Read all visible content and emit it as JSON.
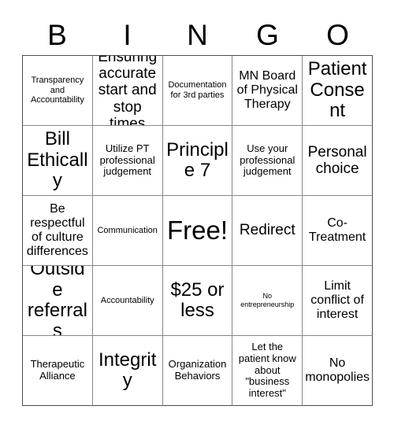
{
  "card": {
    "header_letters": [
      "B",
      "I",
      "N",
      "G",
      "O"
    ],
    "rows": [
      [
        {
          "text": "Transparency and Accountability",
          "size": "s-sm"
        },
        {
          "text": "Ensuring accurate start and stop times",
          "size": "s-xl"
        },
        {
          "text": "Documentation for 3rd parties",
          "size": "s-sm"
        },
        {
          "text": "MN Board of Physical Therapy",
          "size": "s-lg"
        },
        {
          "text": "Patient Consent",
          "size": "s-xxl"
        }
      ],
      [
        {
          "text": "Bill Ethically",
          "size": "s-xxl"
        },
        {
          "text": "Utilize PT professional judgement",
          "size": "s-md"
        },
        {
          "text": "Principle 7",
          "size": "s-xxl"
        },
        {
          "text": "Use your professional judgement",
          "size": "s-md"
        },
        {
          "text": "Personal choice",
          "size": "s-xl"
        }
      ],
      [
        {
          "text": "Be respectful of culture differences",
          "size": "s-lg"
        },
        {
          "text": "Communication",
          "size": "s-sm"
        },
        {
          "text": "Free!",
          "size": "s-free"
        },
        {
          "text": "Redirect",
          "size": "s-xl"
        },
        {
          "text": "Co-Treatment",
          "size": "s-lg"
        }
      ],
      [
        {
          "text": "Outside referrals",
          "size": "s-xxl"
        },
        {
          "text": "Accountability",
          "size": "s-sm"
        },
        {
          "text": "$25 or less",
          "size": "s-xxl"
        },
        {
          "text": "No entrepreneurship",
          "size": "s-xs"
        },
        {
          "text": "Limit conflict of interest",
          "size": "s-lg"
        }
      ],
      [
        {
          "text": "Therapeutic Alliance",
          "size": "s-md"
        },
        {
          "text": "Integrity",
          "size": "s-xxl"
        },
        {
          "text": "Organization Behaviors",
          "size": "s-md"
        },
        {
          "text": "Let the patient know about \"business interest\"",
          "size": "s-md"
        },
        {
          "text": "No monopolies",
          "size": "s-lg"
        }
      ]
    ]
  },
  "colors": {
    "background": "#ffffff",
    "text": "#000000",
    "grid_line": "#878787",
    "grid_border": "#4d4d4d"
  }
}
